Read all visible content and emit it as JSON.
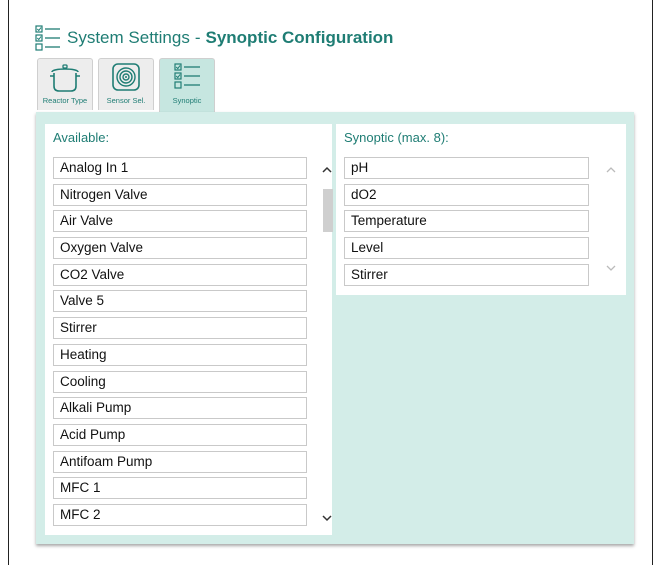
{
  "header": {
    "title_prefix": "System Settings",
    "title_separator": "-",
    "title_main": "Synoptic Configuration",
    "icon": "checklist-icon"
  },
  "tabs": [
    {
      "label": "Reactor Type",
      "icon": "pot-icon",
      "active": false
    },
    {
      "label": "Sensor Sel.",
      "icon": "sensor-target-icon",
      "active": false
    },
    {
      "label": "Synoptic",
      "icon": "checklist-icon",
      "active": true
    }
  ],
  "available": {
    "title": "Available:",
    "items": [
      "Analog In 1",
      "Nitrogen Valve",
      "Air Valve",
      "Oxygen Valve",
      "CO2 Valve",
      "Valve 5",
      "Stirrer",
      "Heating",
      "Cooling",
      "Alkali Pump",
      "Acid Pump",
      "Antifoam Pump",
      "MFC 1",
      "MFC 2"
    ]
  },
  "synoptic": {
    "title": "Synoptic (max. 8):",
    "items": [
      "pH",
      "dO2",
      "Temperature",
      "Level",
      "Stirrer"
    ]
  },
  "colors": {
    "accent": "#1f7d74",
    "panel_bg": "#d3ede8",
    "active_tab_bg": "#c6e6e0"
  }
}
